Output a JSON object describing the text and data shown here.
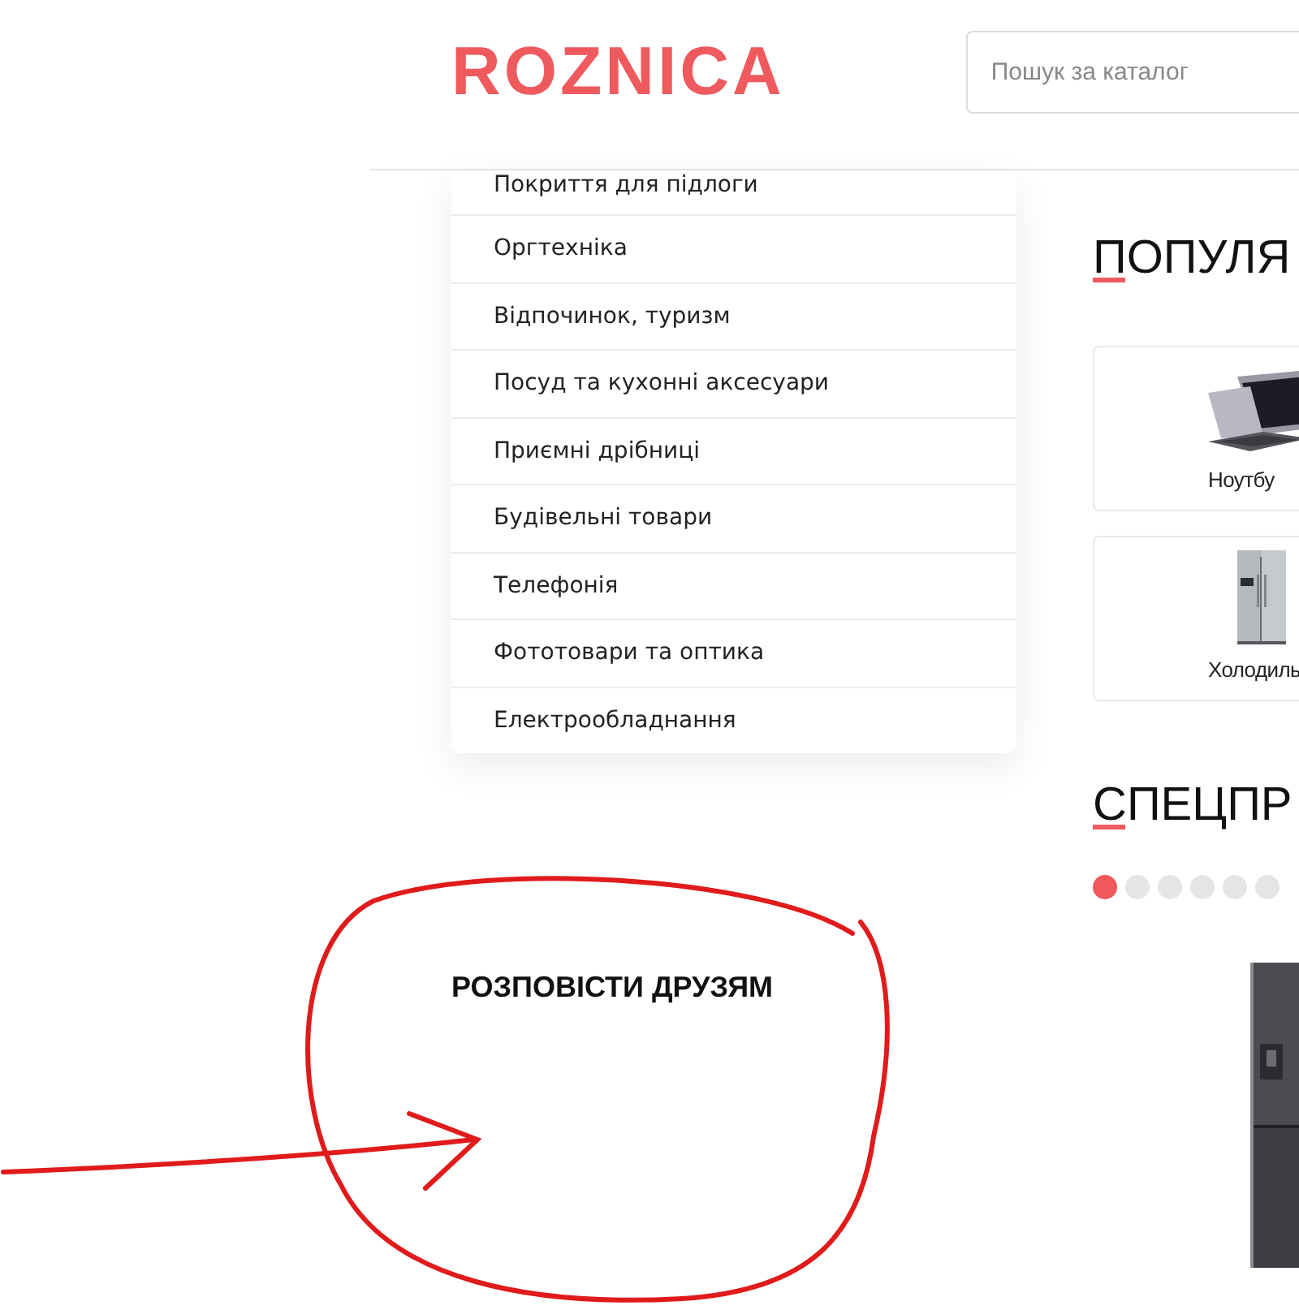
{
  "header": {
    "logo": "ROZNICA",
    "search": {
      "placeholder": "Пошук за каталог"
    }
  },
  "categories": [
    {
      "label": "Покриття для підлоги"
    },
    {
      "label": "Оргтехніка"
    },
    {
      "label": "Відпочинок, туризм"
    },
    {
      "label": "Посуд та кухонні аксесуари"
    },
    {
      "label": "Приємні дрібниці"
    },
    {
      "label": "Будівельні товари"
    },
    {
      "label": "Телефонія"
    },
    {
      "label": "Фототовари та оптика"
    },
    {
      "label": "Електрообладнання"
    }
  ],
  "share": {
    "title": "РОЗПОВІСТИ ДРУЗЯМ"
  },
  "popular": {
    "title": "ПОПУЛЯ",
    "items": [
      {
        "label": "Ноутбу",
        "kind": "laptop"
      },
      {
        "label": "Холодиль",
        "kind": "fridge"
      }
    ]
  },
  "specials": {
    "title": "СПЕЦПР",
    "dots": [
      {
        "selected": true
      },
      {
        "selected": false
      },
      {
        "selected": false
      },
      {
        "selected": false
      },
      {
        "selected": false
      },
      {
        "selected": false
      }
    ]
  }
}
